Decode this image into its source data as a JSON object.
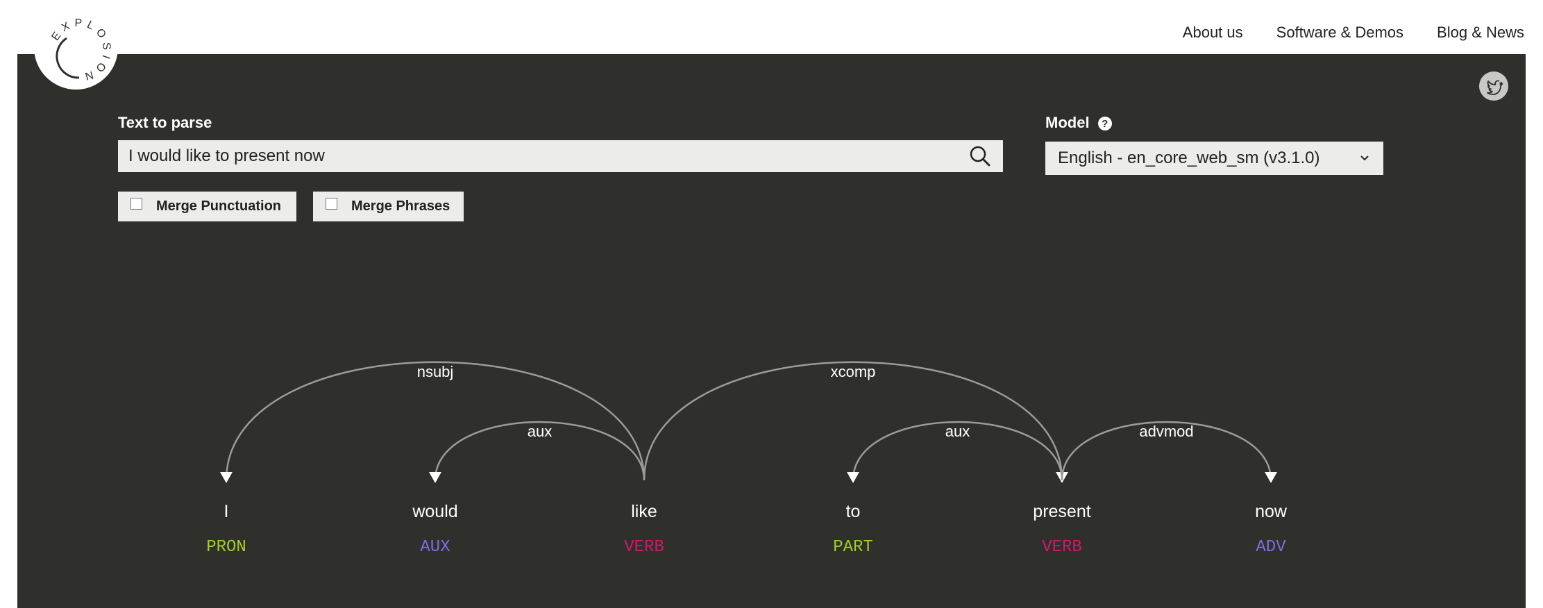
{
  "brand": {
    "logo_text": "EXPLOSION"
  },
  "nav": {
    "items": [
      "About us",
      "Software & Demos",
      "Blog & News"
    ]
  },
  "form": {
    "text_label": "Text to parse",
    "text_value": "I would like to present now",
    "model_label": "Model",
    "model_help": "?",
    "model_value": "English - en_core_web_sm (v3.1.0)",
    "merge_punct_label": "Merge Punctuation",
    "merge_phrases_label": "Merge Phrases",
    "merge_punct_checked": false,
    "merge_phrases_checked": false
  },
  "parse": {
    "words": [
      {
        "text": "I",
        "tag": "PRON"
      },
      {
        "text": "would",
        "tag": "AUX"
      },
      {
        "text": "like",
        "tag": "VERB"
      },
      {
        "text": "to",
        "tag": "PART"
      },
      {
        "text": "present",
        "tag": "VERB"
      },
      {
        "text": "now",
        "tag": "ADV"
      }
    ],
    "arcs": [
      {
        "label": "nsubj",
        "head": 2,
        "dep": 0
      },
      {
        "label": "aux",
        "head": 2,
        "dep": 1
      },
      {
        "label": "xcomp",
        "head": 2,
        "dep": 4
      },
      {
        "label": "aux",
        "head": 4,
        "dep": 3
      },
      {
        "label": "advmod",
        "head": 4,
        "dep": 5
      }
    ],
    "tag_colors": {
      "PRON": "#a3cd2d",
      "AUX": "#7b6fe0",
      "VERB": "#d4176b",
      "PART": "#a3cd2d",
      "ADV": "#7b6fe0"
    }
  },
  "colors": {
    "background": "#2f2f2b",
    "arc": "#9b9b97",
    "field": "#ececea"
  }
}
